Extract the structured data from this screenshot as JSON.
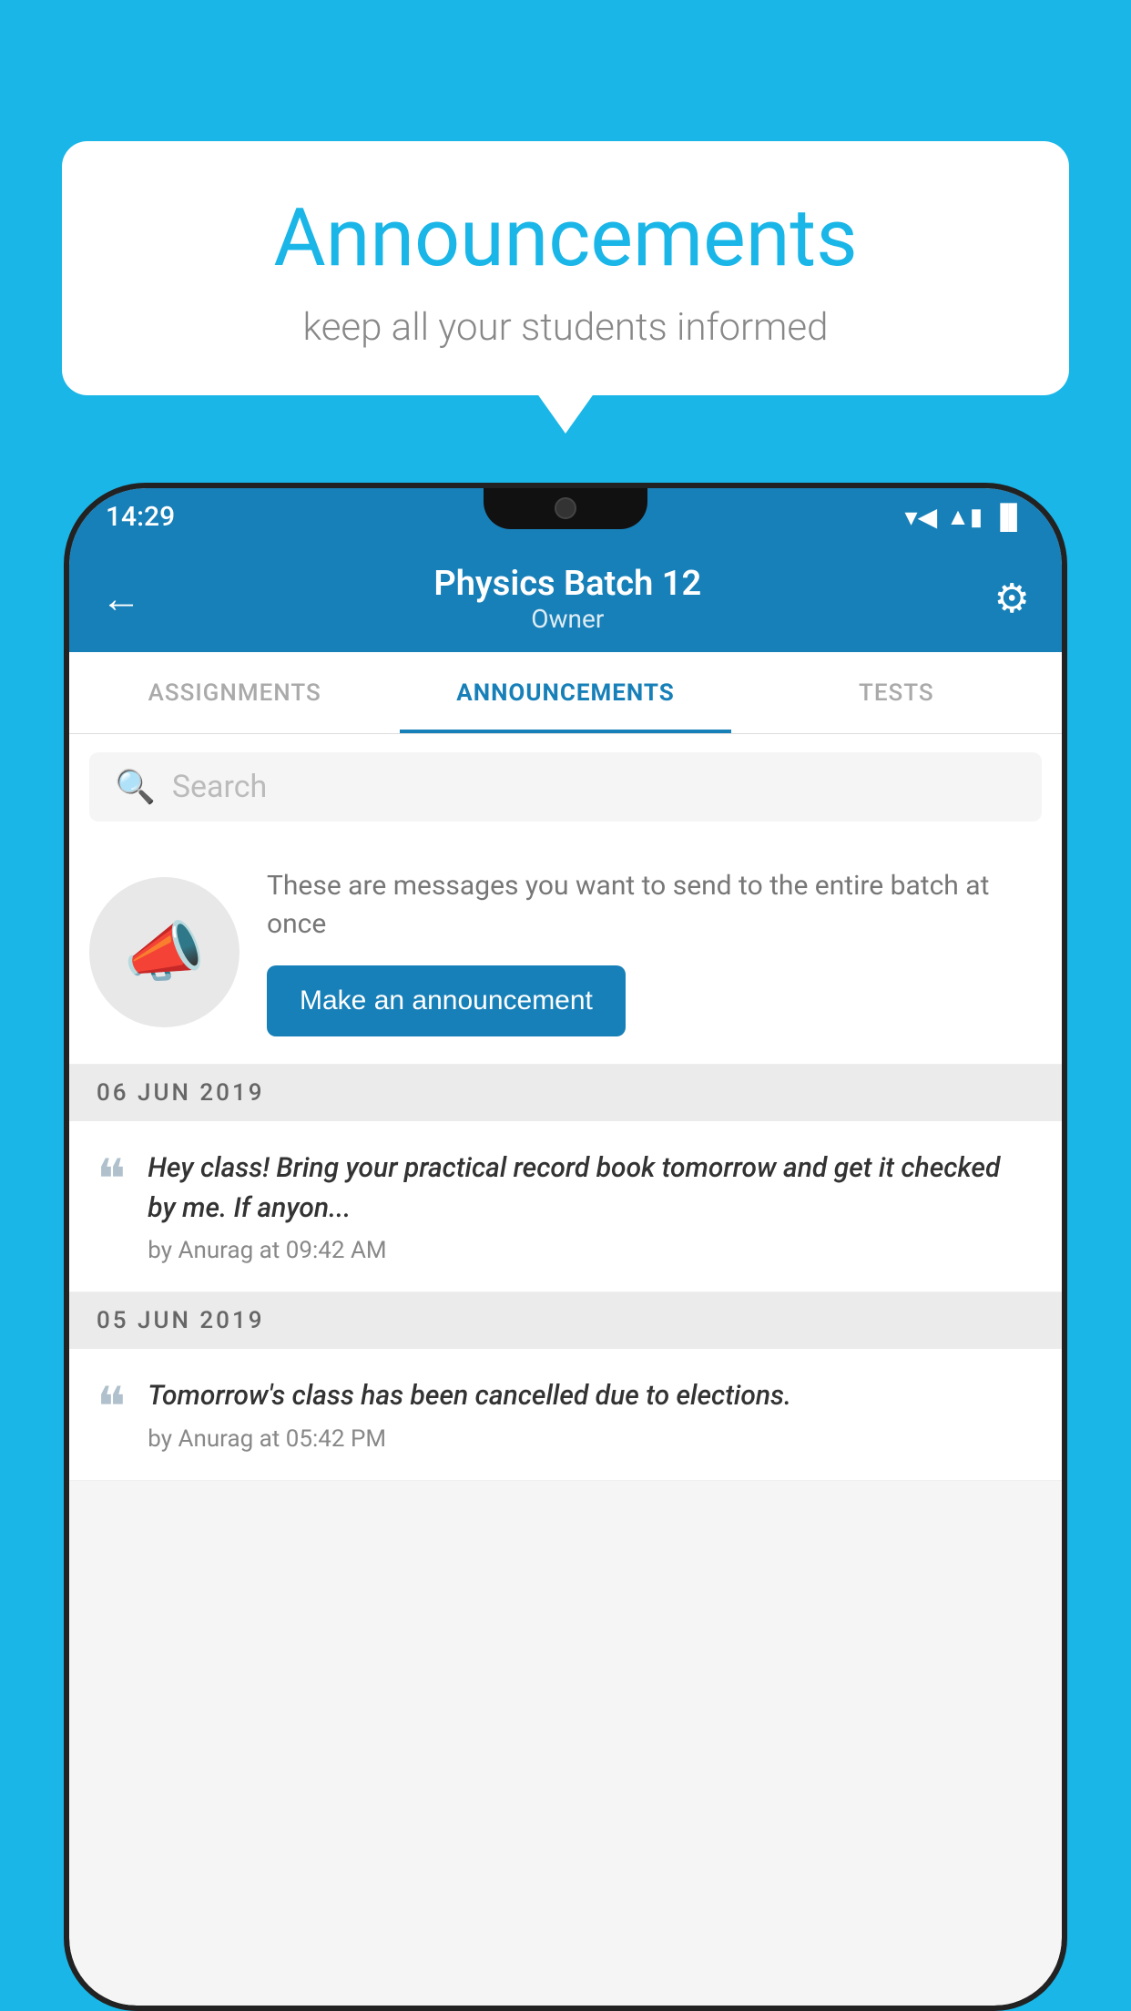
{
  "background_color": "#1ab6e8",
  "bubble": {
    "title": "Announcements",
    "subtitle": "keep all your students informed"
  },
  "phone": {
    "status_bar": {
      "time": "14:29",
      "wifi": "▼",
      "signal": "▲",
      "battery": "▪"
    },
    "header": {
      "title": "Physics Batch 12",
      "subtitle": "Owner",
      "back_label": "←",
      "gear_label": "⚙"
    },
    "tabs": [
      {
        "label": "ASSIGNMENTS",
        "active": false
      },
      {
        "label": "ANNOUNCEMENTS",
        "active": true
      },
      {
        "label": "TESTS",
        "active": false
      }
    ],
    "search": {
      "placeholder": "Search"
    },
    "promo": {
      "description": "These are messages you want to send to the entire batch at once",
      "button_label": "Make an announcement"
    },
    "date_groups": [
      {
        "date": "06  JUN  2019",
        "announcements": [
          {
            "text": "Hey class! Bring your practical record book tomorrow and get it checked by me. If anyon...",
            "author": "by Anurag at 09:42 AM"
          }
        ]
      },
      {
        "date": "05  JUN  2019",
        "announcements": [
          {
            "text": "Tomorrow's class has been cancelled due to elections.",
            "author": "by Anurag at 05:42 PM"
          }
        ]
      }
    ]
  }
}
